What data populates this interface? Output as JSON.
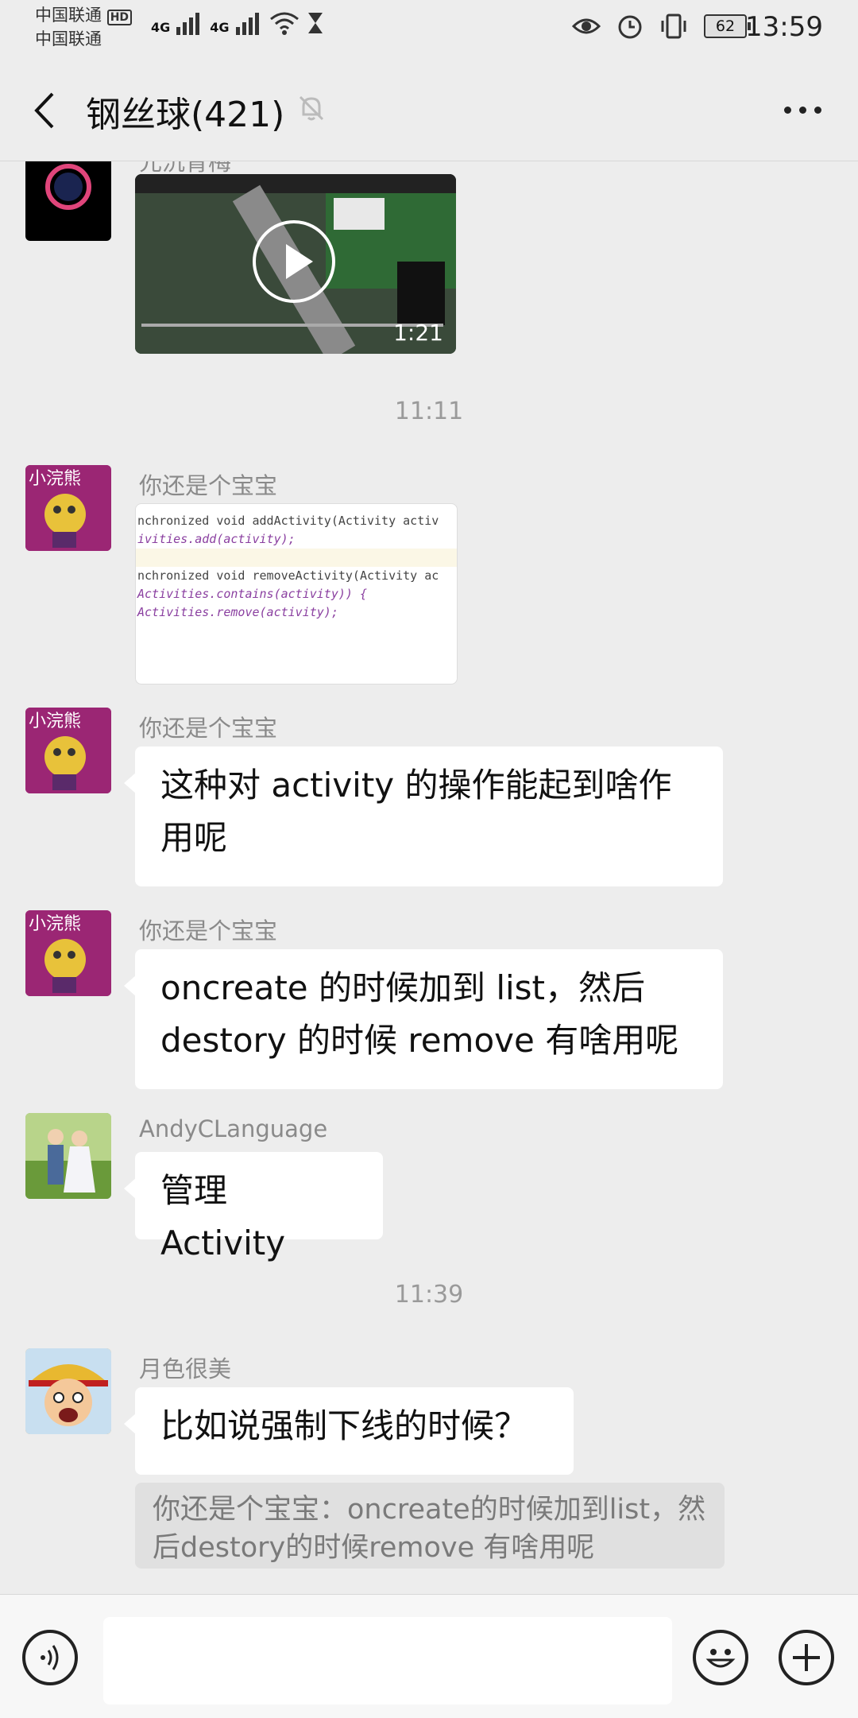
{
  "status_bar": {
    "carrier_1": "中国联通",
    "carrier_2": "中国联通",
    "hd_badge": "HD",
    "network_1": "4G",
    "network_2": "4G",
    "battery": "62",
    "time": "13:59"
  },
  "header": {
    "title": "钢丝球(421)"
  },
  "messages": {
    "video": {
      "sender": "元沉青梅",
      "duration": "1:21"
    },
    "timestamp_1": "11:11",
    "image_msg": {
      "sender": "你还是个宝宝",
      "code_lines": [
        "nchronized void addActivity(Activity activ",
        "ivities.add(activity);",
        "",
        "",
        "nchronized void removeActivity(Activity ac",
        "Activities.contains(activity)) {",
        "Activities.remove(activity);"
      ]
    },
    "msg_1": {
      "sender": "你还是个宝宝",
      "text": "这种对 activity 的操作能起到啥作用呢"
    },
    "msg_2": {
      "sender": "你还是个宝宝",
      "text": "oncreate 的时候加到 list，然后 destory 的时候 remove   有啥用呢"
    },
    "msg_3": {
      "sender": "AndyCLanguage",
      "text": "管理 Activity"
    },
    "timestamp_2": "11:39",
    "msg_4": {
      "sender": "月色很美",
      "text": "比如说强制下线的时候？",
      "quote": "你还是个宝宝：oncreate的时候加到list，然后destory的时候remove   有啥用呢"
    }
  },
  "input": {
    "placeholder": ""
  },
  "colors": {
    "background": "#ededed",
    "bubble": "#ffffff",
    "quote_bg": "#e0e0e0"
  }
}
